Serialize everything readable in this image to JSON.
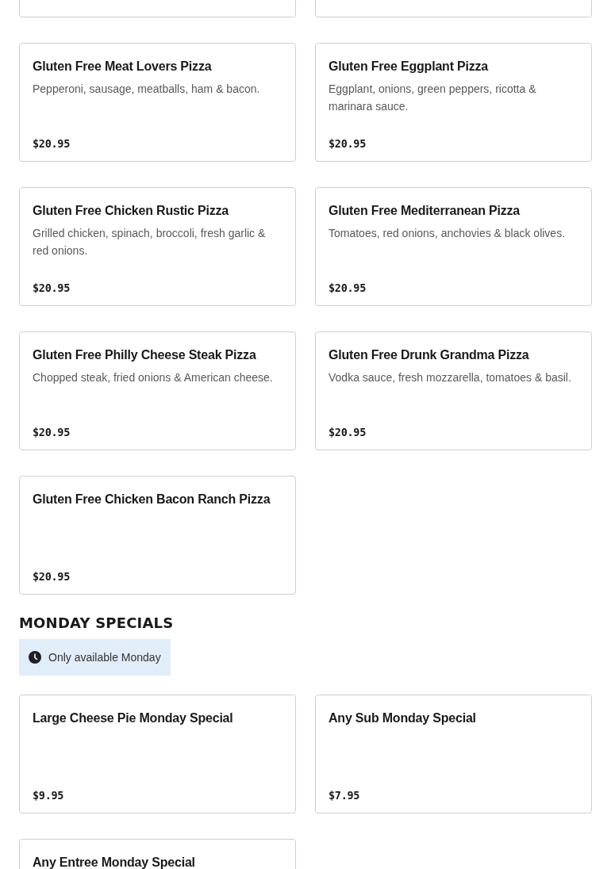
{
  "sections": [
    {
      "items": [
        {
          "kind": "clipped"
        },
        {
          "kind": "clipped"
        },
        {
          "kind": "item",
          "name": "Gluten Free Meat Lovers Pizza",
          "description": "Pepperoni, sausage, meatballs, ham & bacon.",
          "price": "$20.95"
        },
        {
          "kind": "item",
          "name": "Gluten Free Eggplant Pizza",
          "description": "Eggplant, onions, green peppers, ricotta & marinara sauce.",
          "price": "$20.95"
        },
        {
          "kind": "item",
          "name": "Gluten Free Chicken Rustic Pizza",
          "description": "Grilled chicken, spinach, broccoli, fresh garlic & red onions.",
          "price": "$20.95"
        },
        {
          "kind": "item",
          "name": "Gluten Free Mediterranean Pizza",
          "description": "Tomatoes, red onions, anchovies & black olives.",
          "price": "$20.95"
        },
        {
          "kind": "item",
          "name": "Gluten Free Philly Cheese Steak Pizza",
          "description": "Chopped steak, fried onions & American cheese.",
          "price": "$20.95"
        },
        {
          "kind": "item",
          "name": "Gluten Free Drunk Grandma Pizza",
          "description": "Vodka sauce, fresh mozzarella, tomatoes & basil.",
          "price": "$20.95"
        },
        {
          "kind": "item",
          "name": "Gluten Free Chicken Bacon Ranch Pizza",
          "price": "$20.95"
        }
      ]
    },
    {
      "title": "MONDAY SPECIALS",
      "notice": "Only available Monday",
      "items": [
        {
          "kind": "item",
          "name": "Large Cheese Pie Monday Special",
          "price": "$9.95"
        },
        {
          "kind": "item",
          "name": "Any Sub Monday Special",
          "price": "$7.95"
        },
        {
          "kind": "item",
          "name": "Any Entree Monday Special"
        }
      ]
    }
  ]
}
